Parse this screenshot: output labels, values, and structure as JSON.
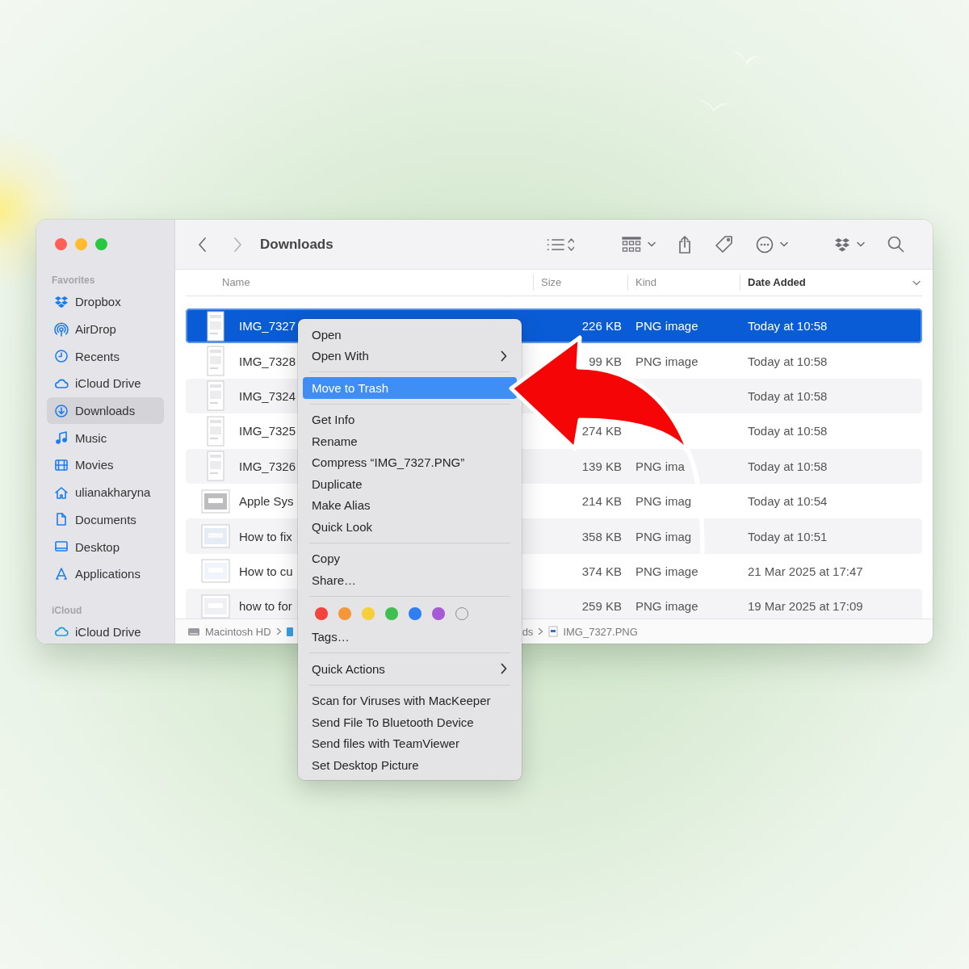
{
  "toolbar": {
    "title": "Downloads"
  },
  "sidebar": {
    "sections": [
      {
        "heading": "Favorites",
        "items": [
          {
            "label": "Dropbox",
            "selected": false
          },
          {
            "label": "AirDrop",
            "selected": false
          },
          {
            "label": "Recents",
            "selected": false
          },
          {
            "label": "iCloud Drive",
            "selected": false
          },
          {
            "label": "Downloads",
            "selected": true
          },
          {
            "label": "Music",
            "selected": false
          },
          {
            "label": "Movies",
            "selected": false
          },
          {
            "label": "ulianakharyna",
            "selected": false
          },
          {
            "label": "Documents",
            "selected": false
          },
          {
            "label": "Desktop",
            "selected": false
          },
          {
            "label": "Applications",
            "selected": false
          }
        ]
      },
      {
        "heading": "iCloud",
        "items": [
          {
            "label": "iCloud Drive",
            "selected": false
          }
        ]
      }
    ]
  },
  "table": {
    "columns": [
      {
        "label": "Name",
        "sorted": false
      },
      {
        "label": "Size",
        "sorted": false
      },
      {
        "label": "Kind",
        "sorted": false
      },
      {
        "label": "Date Added",
        "sorted": true
      }
    ],
    "rows": [
      {
        "name": "IMG_7327",
        "size": "226 KB",
        "kind": "PNG image",
        "date": "Today at 10:58",
        "selected": true
      },
      {
        "name": "IMG_7328",
        "size": "99 KB",
        "kind": "PNG image",
        "date": "Today at 10:58",
        "selected": false
      },
      {
        "name": "IMG_7324",
        "date": "Today at 10:58",
        "selected": false
      },
      {
        "name": "IMG_7325",
        "size": "274 KB",
        "date": "Today at 10:58",
        "selected": false
      },
      {
        "name": "IMG_7326",
        "size": "139 KB",
        "kind": "PNG ima",
        "date": "Today at 10:58",
        "selected": false
      },
      {
        "name": "Apple Sys",
        "size": "214 KB",
        "kind": "PNG imag",
        "date": "Today at 10:54",
        "selected": false
      },
      {
        "name": "How to fix",
        "size": "358 KB",
        "kind": "PNG imag",
        "date": "Today at 10:51",
        "selected": false
      },
      {
        "name": "How to cu",
        "size": "374 KB",
        "kind": "PNG image",
        "date": "21 Mar 2025 at 17:47",
        "selected": false
      },
      {
        "name": "how to for",
        "size": "259 KB",
        "kind": "PNG image",
        "date": "19 Mar 2025 at 17:09",
        "selected": false
      }
    ]
  },
  "status_bar": {
    "path": [
      "Macintosh HD",
      "ds",
      "IMG_7327.PNG"
    ]
  },
  "context_menu": {
    "items": [
      {
        "kind": "item",
        "label": "Open",
        "selected": false
      },
      {
        "kind": "submenu",
        "label": "Open With",
        "selected": false
      },
      {
        "kind": "separator"
      },
      {
        "kind": "item",
        "label": "Move to Trash",
        "selected": true
      },
      {
        "kind": "separator"
      },
      {
        "kind": "item",
        "label": "Get Info",
        "selected": false
      },
      {
        "kind": "item",
        "label": "Rename",
        "selected": false
      },
      {
        "kind": "item",
        "label": "Compress “IMG_7327.PNG”",
        "selected": false
      },
      {
        "kind": "item",
        "label": "Duplicate",
        "selected": false
      },
      {
        "kind": "item",
        "label": "Make Alias",
        "selected": false
      },
      {
        "kind": "item",
        "label": "Quick Look",
        "selected": false
      },
      {
        "kind": "separator"
      },
      {
        "kind": "item",
        "label": "Copy",
        "selected": false
      },
      {
        "kind": "item",
        "label": "Share…",
        "selected": false
      },
      {
        "kind": "separator"
      },
      {
        "kind": "tags",
        "tags": [
          {
            "color": "#f2443a"
          },
          {
            "color": "#f5963a"
          },
          {
            "color": "#f7cf3b"
          },
          {
            "color": "#3fbf50"
          },
          {
            "color": "#2f7ff2"
          },
          {
            "color": "#a55ad6"
          }
        ]
      },
      {
        "kind": "item",
        "label": "Tags…",
        "selected": false
      },
      {
        "kind": "separator"
      },
      {
        "kind": "submenu",
        "label": "Quick Actions",
        "selected": false
      },
      {
        "kind": "separator"
      },
      {
        "kind": "item",
        "label": "Scan for Viruses with MacKeeper",
        "selected": false
      },
      {
        "kind": "item",
        "label": "Send File To Bluetooth Device",
        "selected": false
      },
      {
        "kind": "item",
        "label": "Send files with TeamViewer",
        "selected": false
      },
      {
        "kind": "item",
        "label": "Set Desktop Picture",
        "selected": false
      }
    ]
  }
}
